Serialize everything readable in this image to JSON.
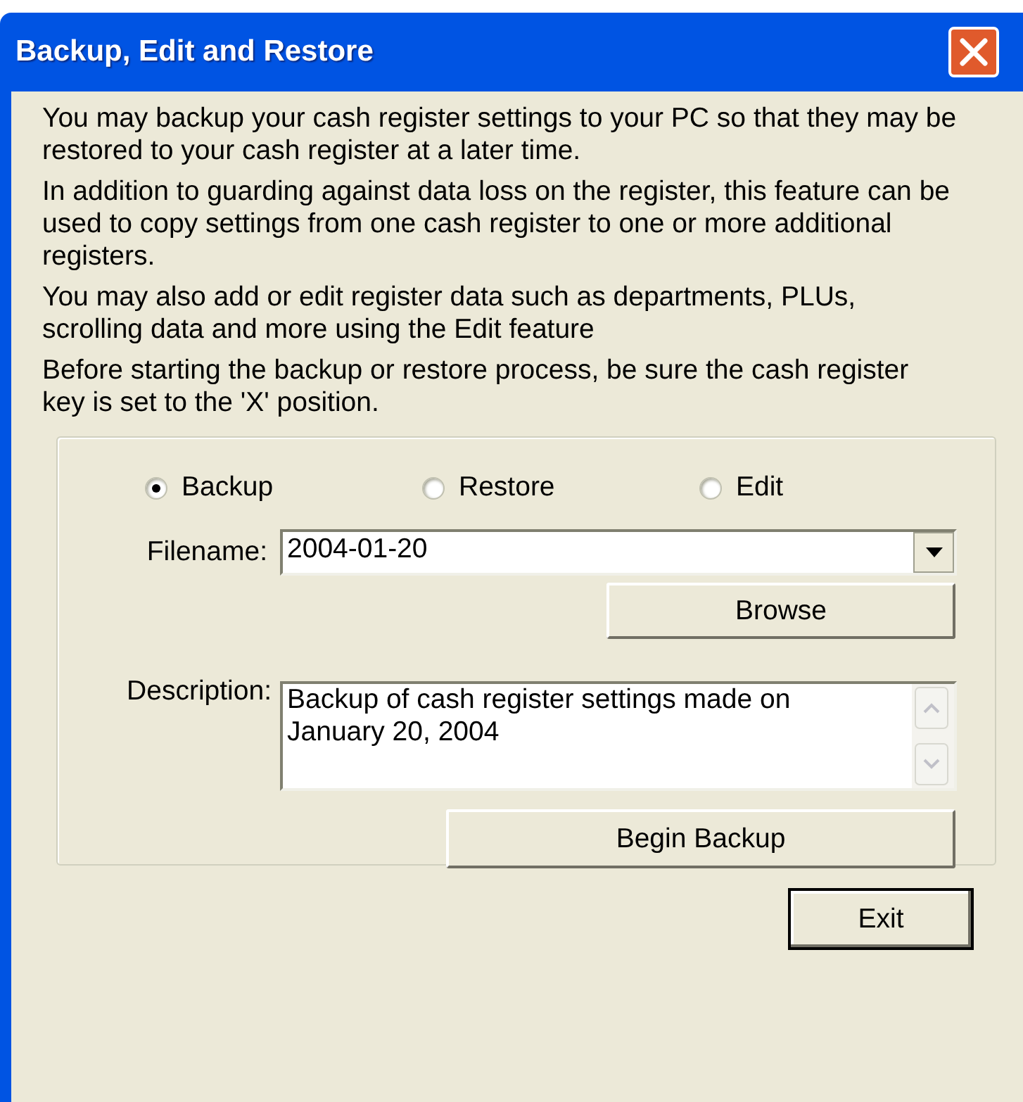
{
  "window": {
    "title": "Backup, Edit and Restore"
  },
  "paragraphs": [
    "You may backup your cash register settings to your PC so that they may be restored to your cash register at a later time.",
    "In addition to guarding against data loss on the register, this feature can be used to copy settings from one cash register to one or more additional registers.",
    "You may also add or edit register data such as departments, PLUs, scrolling data and more using the Edit feature",
    "Before starting the backup or restore process, be sure the cash register key is set to the 'X' position."
  ],
  "modes": [
    {
      "label": "Backup",
      "selected": true
    },
    {
      "label": "Restore",
      "selected": false
    },
    {
      "label": "Edit",
      "selected": false
    }
  ],
  "filename": {
    "label": "Filename:",
    "value": "2004-01-20"
  },
  "browse_button": "Browse",
  "description": {
    "label": "Description:",
    "value": "Backup of cash register settings made on January 20, 2004"
  },
  "begin_button": "Begin Backup",
  "exit_button": "Exit"
}
